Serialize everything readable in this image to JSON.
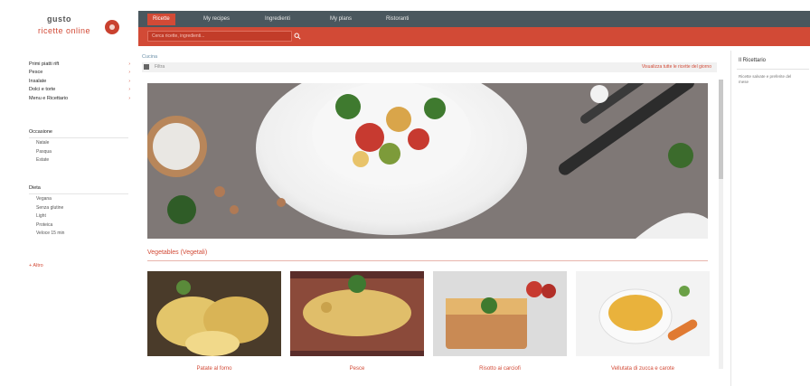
{
  "brand": {
    "top": "gusto",
    "bottom": "ricette online"
  },
  "nav": {
    "tabs": [
      {
        "label": "Ricette",
        "active": true
      },
      {
        "label": "My recipes",
        "active": false
      },
      {
        "label": "Ingredienti",
        "active": false
      },
      {
        "label": "My plans",
        "active": false
      },
      {
        "label": "Ristoranti",
        "active": false
      }
    ],
    "search_placeholder": "Cerca ricette, ingredienti...",
    "search_icon": "search-icon"
  },
  "sidebar": {
    "items": [
      {
        "label": "Primi piatti rift"
      },
      {
        "label": "Pesce"
      },
      {
        "label": "Insalate"
      },
      {
        "label": "Dolci e torte"
      },
      {
        "label": "Menu e Ricettario"
      }
    ],
    "sections": [
      {
        "title": "Occasione",
        "items": [
          "Natale",
          "Pasqua",
          "Estate"
        ]
      },
      {
        "title": "Dieta",
        "items": [
          "Vegana",
          "Senza glutine",
          "Light",
          "Proteica",
          "Veloce 15 min"
        ]
      }
    ],
    "more_label": "+ Altro"
  },
  "main": {
    "breadcrumb": "Cucina",
    "sublabel": "Filtra",
    "sublink": "Visualizza tutte le ricette del giorno",
    "section_title": "Vegetables (Vegetali)",
    "cards": [
      {
        "caption": "Patate al forno"
      },
      {
        "caption": "Pesce"
      },
      {
        "caption": "Risotto ai carciofi"
      },
      {
        "caption": "Vellutata di zucca e carote"
      }
    ]
  },
  "right": {
    "title": "Il Ricettario",
    "text": "Ricette salvate e preferite del mese"
  },
  "colors": {
    "accent": "#d24a36",
    "nav": "#4a575e"
  }
}
